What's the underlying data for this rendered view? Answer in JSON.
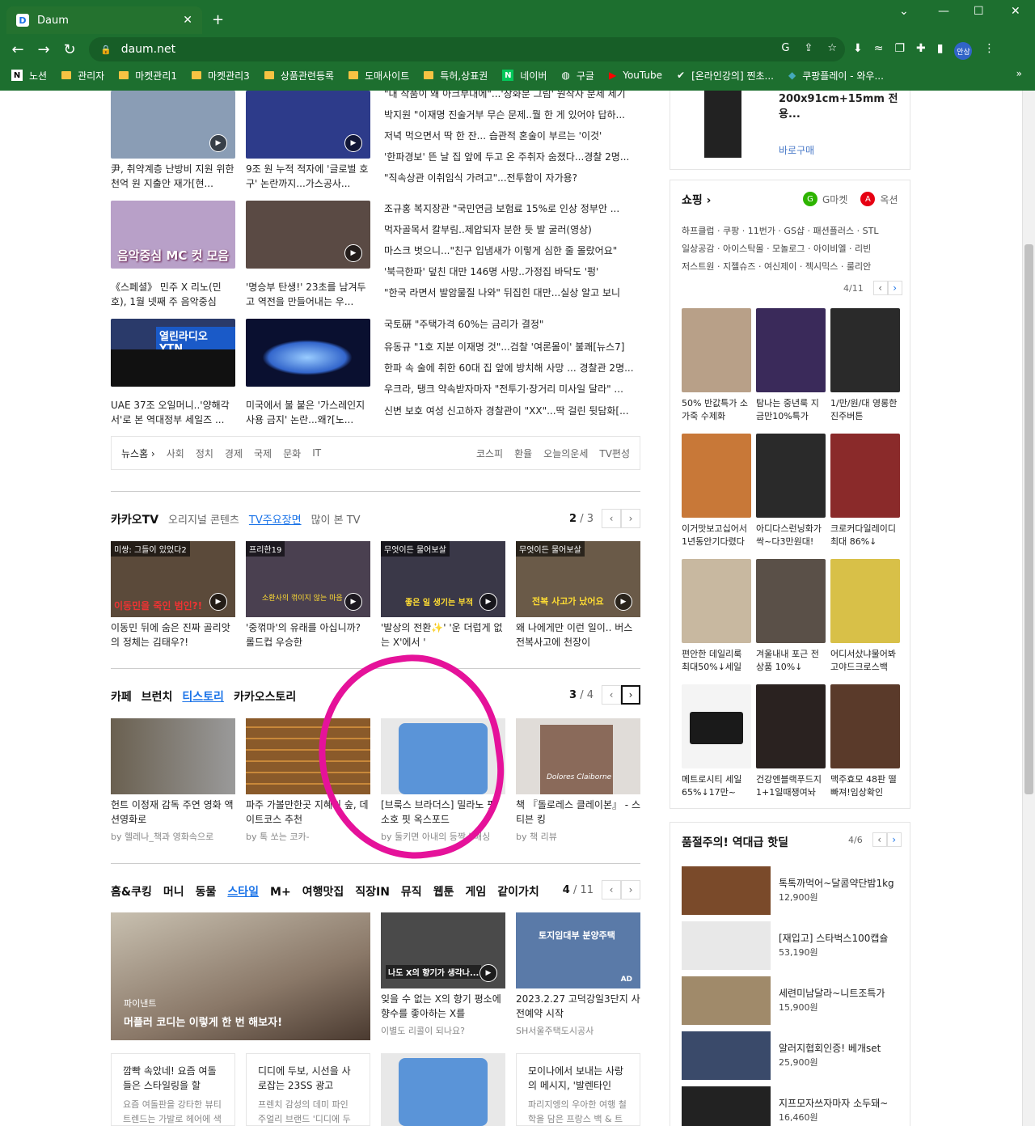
{
  "browser": {
    "tab_title": "Daum",
    "tab_favicon": "D",
    "url": "daum.net",
    "avatar_text": "안상",
    "bookmarks": [
      "노션",
      "관리자",
      "마켓관리1",
      "마켓관리3",
      "상품관련등록",
      "도매사이트",
      "특허,상표권",
      "네이버",
      "구글",
      "YouTube",
      "[온라인강의] 찐초...",
      "쿠팡플레이 - 와우..."
    ]
  },
  "news": {
    "thumbs": [
      {
        "caption": "尹, 취약계층 난방비 지원 위한 천억 원 지출안 재가[현...",
        "color": "#8a9db5"
      },
      {
        "caption": "9조 원 누적 적자에 '글로벌 호구' 논란까지...가스공사...",
        "color": "#2d3b8a"
      },
      {
        "caption": "《스페셜》 민주 X 리노(민호), 1월 넷째 주 음악중심 MC...",
        "color": "#b8a0c8",
        "overlay": "음악중심 MC 컷 모음"
      },
      {
        "caption": "'명승부 탄생!' 23초를 남겨두고 역전을 만들어내는 우...",
        "color": "#5a4a44"
      },
      {
        "caption": "UAE 37조 오일머니..'양해각서'로 본 역대정부 세일즈 ...",
        "color": "#2a3a6a",
        "overlay": "열린라디오 YTN"
      },
      {
        "caption": "미국에서 불 붙은 '가스레인지 사용 금지' 논란...왜?[노...",
        "color": "#1a2a6a"
      }
    ],
    "headlines": [
      "\"내 작품이 왜 아크부대에\"...'창화분 그림' 원작자 분제 제기",
      "박지원 \"이재명 진술거부 무슨 문제..뭘 한 게 있어야 답하...",
      "저녁 먹으면서 딱 한 잔... 습관적 혼술이 부르는 '이것'",
      "'한파경보' 뜬 날 집 앞에 두고 온 주취자 숨졌다...경찰 2명...",
      "\"직속상관 이취임식 가려고\"...전투함이 자가용?",
      "조규홍 복지장관 \"국민연금 보험료 15%로 인상 정부안 ...",
      "먹자골목서 칼부림..제압되자 분한 듯 발 굴러(영상)",
      "마스크 벗으니...\"친구 입냄새가 이렇게 심한 줄 몰랐어요\"",
      "'북극한파' 덮친 대만 146명 사망..가정집 바닥도 '펑'",
      "\"한국 라면서 발암물질 나와\" 뒤집힌 대만...실상 알고 보니",
      "국토硏 \"주택가격 60%는 금리가 결정\"",
      "유동규 \"1호 지분 이재명 것\"...검찰 '여론몰이' 불쾌[뉴스7]",
      "한파 속 술에 취한 60대 집 앞에 방치해 사망 ... 경찰관 2명...",
      "우크라, 탱크 약속받자마자 \"전투기·장거리 미사일 달라\" ...",
      "신변 보호 여성 신고하자 경찰관이 \"XX\"...딱 걸린 뒷담화[..."
    ],
    "bar_left": [
      "뉴스홈 ›",
      "사회",
      "정치",
      "경제",
      "국제",
      "문화",
      "IT"
    ],
    "bar_right": [
      "코스피",
      "환율",
      "오늘의운세",
      "TV편성"
    ]
  },
  "kakaotv": {
    "title": "카카오TV",
    "tabs": [
      "오리지널 콘텐츠",
      "TV주요장면",
      "많이 본 TV"
    ],
    "page_current": "2",
    "page_total": "/ 3",
    "cards": [
      {
        "tag": "미쌍: 그들이 있었다2",
        "text": "이동민 뒤에 숨은 진짜 골리앗의 정체는 김태우?!",
        "color": "#5b4a3a",
        "overlay": "이동민을 죽인 범인?!"
      },
      {
        "tag": "프리한19",
        "text": "'중꺾마'의 유래를 아십니까? 롤드컵 우승한",
        "color": "#4a4050",
        "overlay": "소환사의 꺾이지 않는 마음"
      },
      {
        "tag": "무엇이든 물어보살",
        "text": "'발상의 전환✨' '운 더럽게 없는 X'에서 '",
        "color": "#3a3848",
        "overlay": "좋은 일 생기는 부적"
      },
      {
        "tag": "무엇이든 물어보살",
        "text": "왜 나에게만 이런 일이.. 버스 전복사고에 천장이",
        "color": "#6a5a48",
        "overlay": "전복 사고가 났어요"
      }
    ]
  },
  "cafe": {
    "tabs": [
      "카페",
      "브런치",
      "티스토리",
      "카카오스토리"
    ],
    "page_current": "3",
    "page_total": "/ 4",
    "cards": [
      {
        "text": "헌트 이정재 감독 주연 영화 액션영화로",
        "by": "by 헬레나_책과 영화속으로",
        "color": "#6a6050"
      },
      {
        "text": "파주 가볼만한곳 지혜의 숲, 데이트코스 추천",
        "by": "by 톡 쏘는 코카-",
        "color": "#8a5a2a"
      },
      {
        "text": "[브룩스 브라더스] 밀라노 핏 소호 핏 옥스포드",
        "by": "by 둘키면 아내의 등짝스매싱",
        "color": "#5a94d8"
      },
      {
        "text": "책 『돌로레스 클레이본』 - 스티븐 킹",
        "by": "by 책 리뷰",
        "color": "#8a6a5a",
        "overlay": "Dolores Claiborne"
      }
    ]
  },
  "home": {
    "tabs": [
      "홈&쿠킹",
      "머니",
      "동물",
      "스타일",
      "M+",
      "여행맛집",
      "직장IN",
      "뮤직",
      "웹툰",
      "게임",
      "같이가치"
    ],
    "page_current": "4",
    "page_total": "/ 11",
    "big": {
      "label": "파이낸트",
      "title": "머플러 코디는 이렇게 한 번 해보자!"
    },
    "cards": [
      {
        "text": "잊을 수 없는 X의 향기 평소에 향수를 좋아하는 X를",
        "sub": "이별도 리콜이 되나요?",
        "color": "#4a4a4a",
        "overlay": "나도 X의 향기가 생각나..."
      },
      {
        "text": "2023.2.27 고덕강일3단지 사전예약 시작",
        "sub": "SH서울주택도시공사",
        "color": "#5a7aa8",
        "overlay": "토지임대부 분양주택"
      }
    ],
    "bottom": [
      {
        "text": "깜빡 속았네! 요즘 여돌들은 스타일링을 할",
        "sub": "요즘 여돌판을 강타한 뷰티 트렌드는 가발로 헤어에 색다"
      },
      {
        "text": "디디에 두보, 시선을 사로잡는 23SS 광고",
        "sub": "프렌치 감성의 데미 파인 주얼리 브랜드 '디디에 두보"
      },
      {
        "text": "",
        "sub": ""
      },
      {
        "text": "모이나에서 보내는 사랑의 메시지, '발렌타인",
        "sub": "파리지엥의 우아한 여행 철학을 담은 프랑스 백 & 트렁크"
      }
    ]
  },
  "ad": {
    "title": "200x91cm+15mm 전용...",
    "link": "바로구매"
  },
  "shopping": {
    "title": "쇼핑 ›",
    "gmarket": "G마켓",
    "auction": "옥션",
    "malls": [
      "하프클럽 · 쿠팡 · 11번가 · GS샵 · 패션플러스 · STL",
      "일상공감 · 아이스탁몰 · 모놀로그 · 아이비엘 · 리빈",
      "저스트원 · 지젤슈즈 · 여신제이 · 젝시믹스 · 룰리안"
    ],
    "page": "4/11",
    "items": [
      {
        "text": "50% 반값특가 소가죽 수제화",
        "color": "#b8a088"
      },
      {
        "text": "탐나는 중년룩 지금만10%특가",
        "color": "#3a2a5a"
      },
      {
        "text": "1/만/원/대 영롱한진주버튼",
        "color": "#2a2a2a"
      },
      {
        "text": "이거맛보고십어서 1년동안기다렸다",
        "color": "#c87838"
      },
      {
        "text": "아디다스런닝화가 싹~다3만원대!",
        "color": "#2a2a2a"
      },
      {
        "text": "크로커다일레이디 최대 86%↓",
        "color": "#8a2a2a"
      },
      {
        "text": "편안한 데일리룩 최대50%↓세일",
        "color": "#c8b8a0"
      },
      {
        "text": "겨울내내 포근 전상품 10%↓",
        "color": "#5a5048"
      },
      {
        "text": "어디서샀냐물어봐 고야드크로스백",
        "color": "#d8c048"
      },
      {
        "text": "메트로시티 세일 65%↓17만~",
        "color": "#1a1a1a"
      },
      {
        "text": "건강엔블랙푸드지 1+1일때쟁여놔",
        "color": "#2a2220"
      },
      {
        "text": "맥주효모 48판 떨빠져!임상확인",
        "color": "#5a3a2a"
      }
    ]
  },
  "hot": {
    "title": "품절주의! 역대급 핫딜",
    "page": "4/6",
    "items": [
      {
        "name": "톡톡까먹어~달콤약단밤1kg",
        "price": "12,900원",
        "color": "#7a4a2a"
      },
      {
        "name": "[재입고] 스타벅스100캡슐",
        "price": "53,190원",
        "color": "#e8e8e8"
      },
      {
        "name": "세련미남달라~니트조특가",
        "price": "15,900원",
        "color": "#a08a6a"
      },
      {
        "name": "알러지협회인증! 베개set",
        "price": "25,900원",
        "color": "#3a4a6a"
      },
      {
        "name": "지프모자쓰자마자 소두돼~",
        "price": "16,460원",
        "color": "#222222"
      }
    ]
  }
}
